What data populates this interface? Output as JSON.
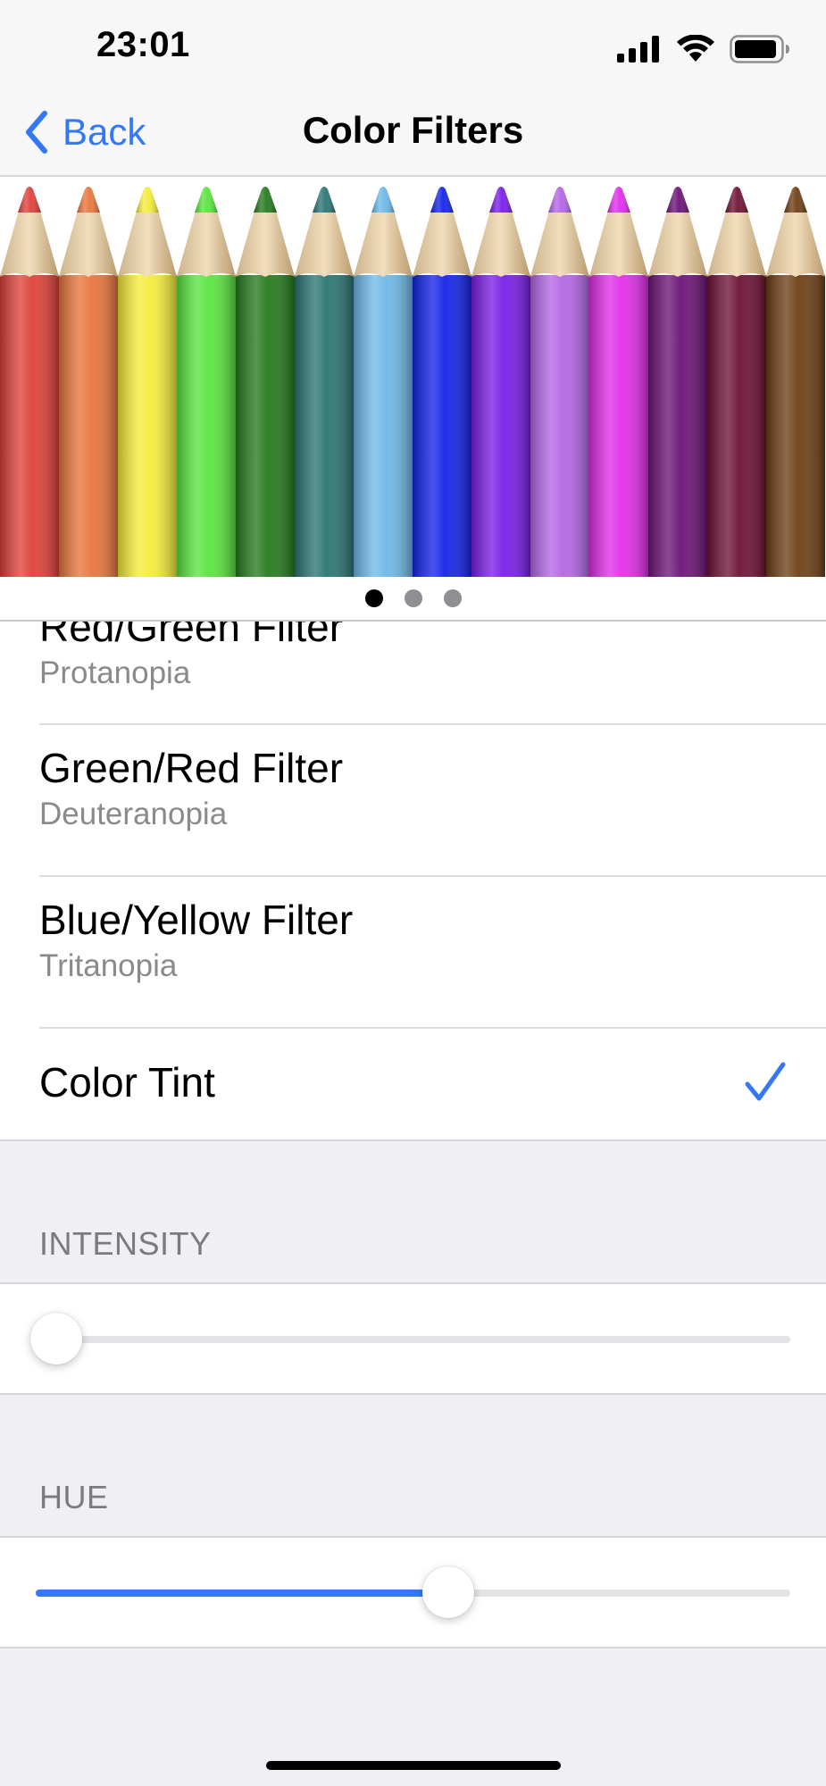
{
  "status_bar": {
    "time": "23:01"
  },
  "nav": {
    "back_label": "Back",
    "title": "Color Filters"
  },
  "pencils": {
    "colors": [
      "#e0413a",
      "#e8763d",
      "#f4ec3c",
      "#5ae43e",
      "#267a1f",
      "#2b7574",
      "#6eb8e8",
      "#1424e8",
      "#7a1ee6",
      "#b566e6",
      "#e02ee8",
      "#6c1478",
      "#6e1234",
      "#6e3f16"
    ]
  },
  "page_control": {
    "count": 3,
    "active": 0
  },
  "filters": {
    "items": [
      {
        "title": "Red/Green Filter",
        "subtitle": "Protanopia"
      },
      {
        "title": "Green/Red Filter",
        "subtitle": "Deuteranopia"
      },
      {
        "title": "Blue/Yellow Filter",
        "subtitle": "Tritanopia"
      },
      {
        "title": "Color Tint"
      }
    ],
    "selected_index": 3
  },
  "intensity": {
    "header": "INTENSITY",
    "value_fraction": 0.0
  },
  "hue": {
    "header": "HUE",
    "value_fraction": 0.55
  },
  "accent_color": "#3478f6"
}
